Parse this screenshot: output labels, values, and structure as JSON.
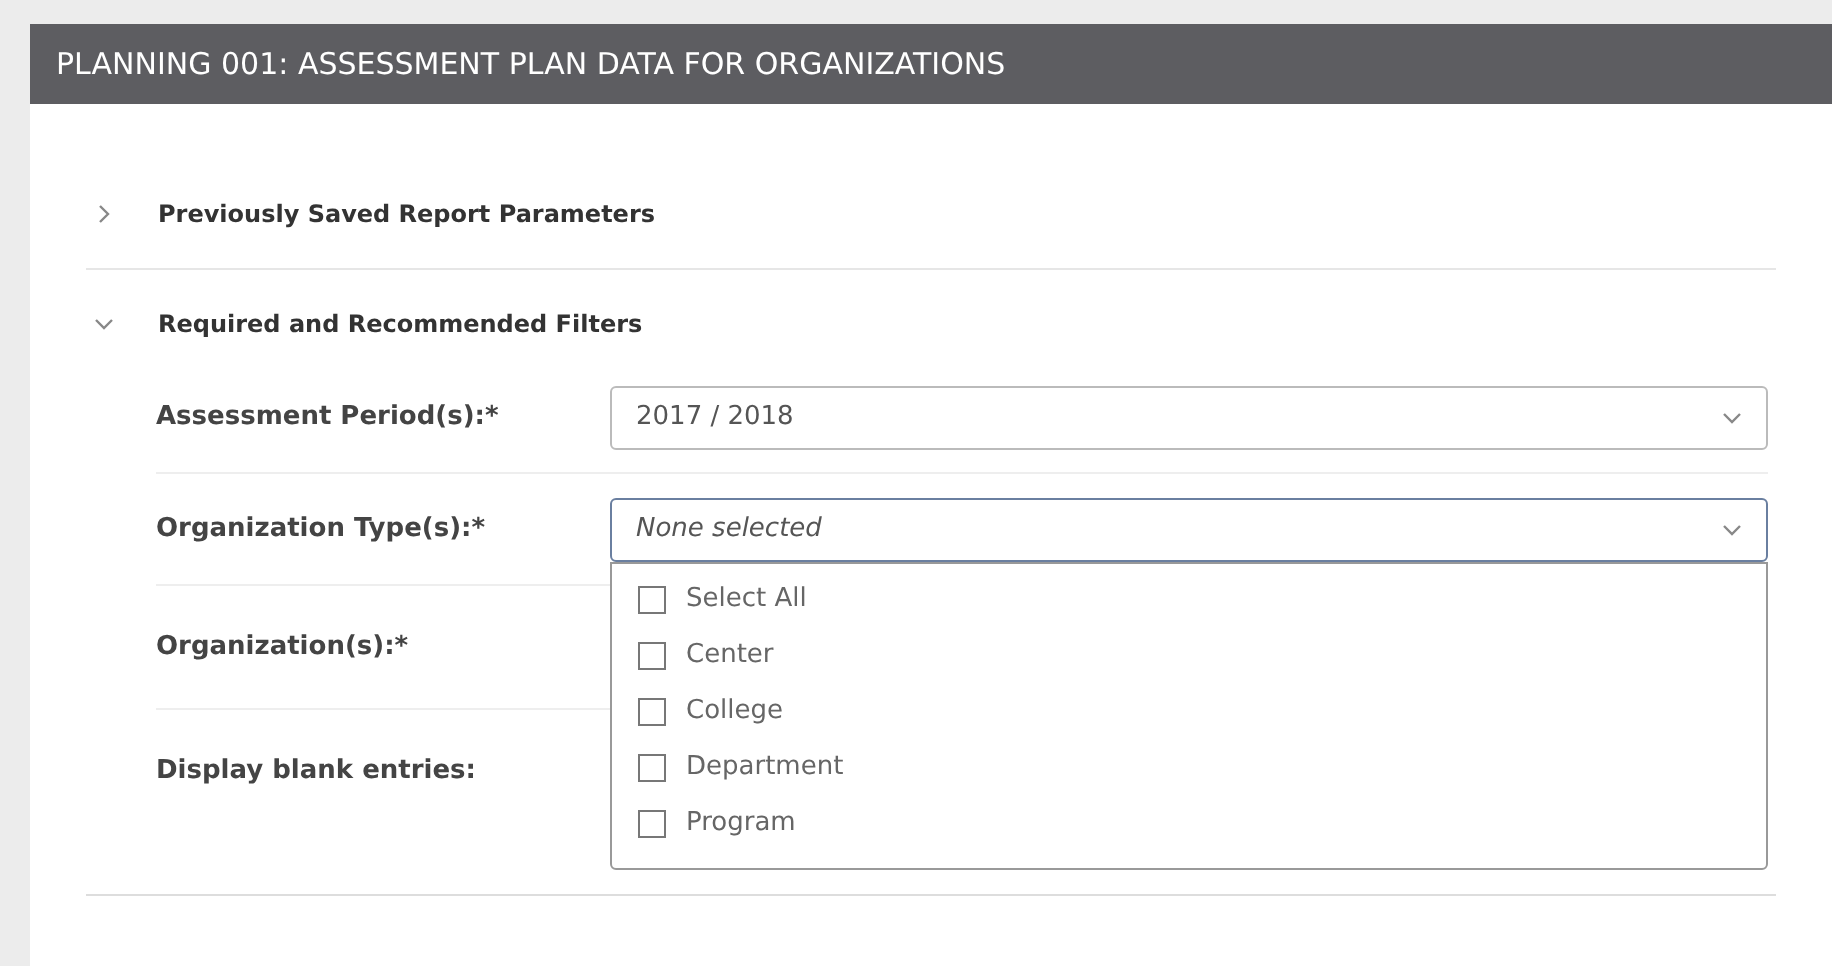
{
  "title": "PLANNING 001: ASSESSMENT PLAN DATA FOR ORGANIZATIONS",
  "sections": [
    {
      "title": "Previously Saved Report Parameters",
      "expanded": false
    },
    {
      "title": "Required and Recommended Filters",
      "expanded": true
    }
  ],
  "filters": [
    {
      "label": "Assessment Period(s):*",
      "kind": "select",
      "value": "2017 / 2018",
      "open": false
    },
    {
      "label": "Organization Type(s):*",
      "kind": "select",
      "placeholder": "None selected",
      "open": true,
      "options": [
        {
          "label": "Select All",
          "checked": false
        },
        {
          "label": "Center",
          "checked": false
        },
        {
          "label": "College",
          "checked": false
        },
        {
          "label": "Department",
          "checked": false
        },
        {
          "label": "Program",
          "checked": false
        }
      ]
    },
    {
      "label": "Organization(s):*",
      "kind": "label"
    },
    {
      "label": "Display blank entries:",
      "kind": "label"
    }
  ]
}
